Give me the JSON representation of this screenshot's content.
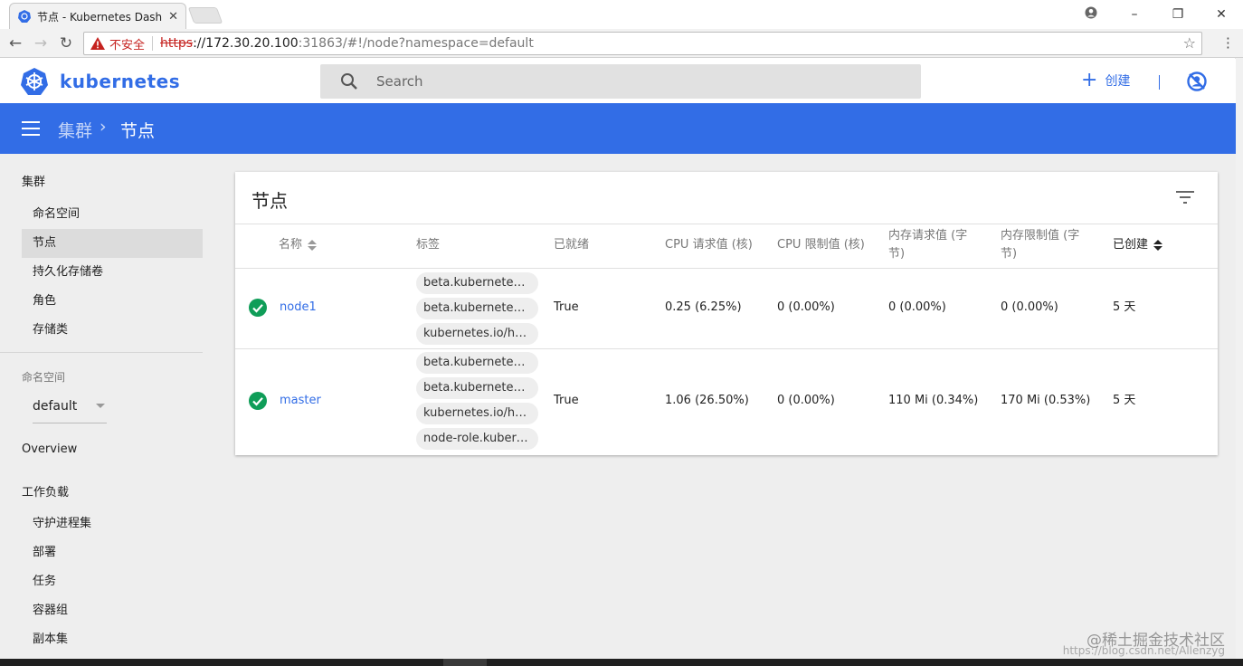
{
  "browser": {
    "tab_title": "节点 - Kubernetes Dash",
    "tab_close": "✕",
    "insecure_label": "不安全",
    "url_scheme": "https",
    "url_host": "://172.30.20.100",
    "url_path": ":31863/#!/node?namespace=default"
  },
  "header": {
    "brand": "kubernetes",
    "search_placeholder": "Search",
    "create_label": "创建"
  },
  "toolbar": {
    "breadcrumb_parent": "集群",
    "breadcrumb_sep": "›",
    "breadcrumb_current": "节点"
  },
  "sidebar": {
    "section_cluster": "集群",
    "cluster_items": [
      "命名空间",
      "节点",
      "持久化存储卷",
      "角色",
      "存储类"
    ],
    "active_item": "节点",
    "namespace_label": "命名空间",
    "namespace_value": "default",
    "overview": "Overview",
    "section_workloads": "工作负载",
    "workload_items": [
      "守护进程集",
      "部署",
      "任务",
      "容器组",
      "副本集"
    ]
  },
  "card": {
    "title": "节点",
    "columns": [
      "名称",
      "标签",
      "已就绪",
      "CPU 请求值 (核)",
      "CPU 限制值 (核)",
      "内存请求值 (字节)",
      "内存限制值 (字节)",
      "已创建"
    ],
    "columns_wrapped": [
      "内存请求值 (字",
      "节)",
      "内存限制值 (字",
      "节)"
    ],
    "rows": [
      {
        "name": "node1",
        "labels": [
          "beta.kubernetes.io/...",
          "beta.kubernetes.io/...",
          "kubernetes.io/host..."
        ],
        "ready": "True",
        "cpu_req": "0.25 (6.25%)",
        "cpu_lim": "0 (0.00%)",
        "mem_req": "0 (0.00%)",
        "mem_lim": "0 (0.00%)",
        "created": "5 天"
      },
      {
        "name": "master",
        "labels": [
          "beta.kubernetes.io/...",
          "beta.kubernetes.io/...",
          "kubernetes.io/host...",
          "node-role.kubernet..."
        ],
        "ready": "True",
        "cpu_req": "1.06 (26.50%)",
        "cpu_lim": "0 (0.00%)",
        "mem_req": "110 Mi (0.34%)",
        "mem_lim": "170 Mi (0.53%)",
        "created": "5 天"
      }
    ]
  },
  "watermark": {
    "line1": "@稀土掘金技术社区",
    "line2": "https://blog.csdn.net/Allenzyg"
  },
  "colors": {
    "brand_blue": "#326de6",
    "status_green": "#0f9d58",
    "insecure_red": "#c5221f"
  },
  "icons": [
    "kubernetes-logo",
    "search-icon",
    "plus-icon",
    "no-auth-icon",
    "menu-icon",
    "filter-icon",
    "check-circle-icon",
    "sort-icon"
  ]
}
